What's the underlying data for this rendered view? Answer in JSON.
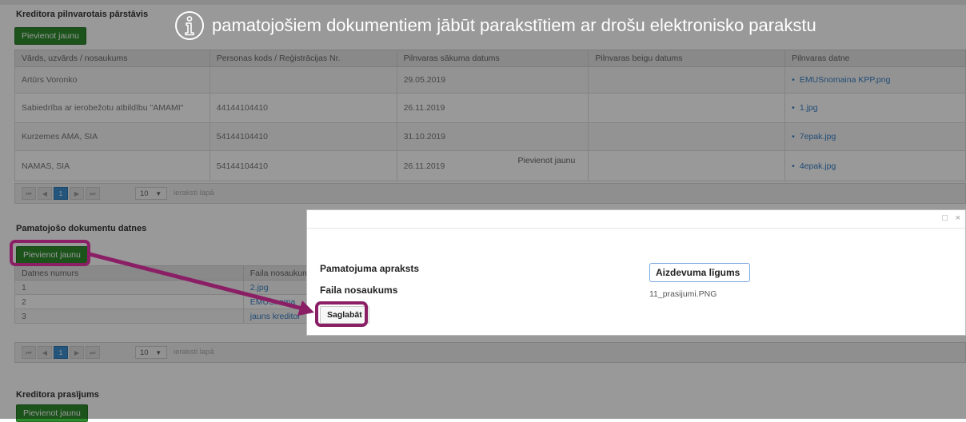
{
  "colors": {
    "primary_green": "#2e8b2e",
    "highlight": "#8b1f66",
    "link": "#3a7fc4",
    "page_active": "#3d8fd0"
  },
  "notice": {
    "icon": "info-circle-icon",
    "text": "pamatojošiem dokumentiem jābūt parakstītiem ar drošu elektronisko parakstu"
  },
  "section1": {
    "title": "Kreditora pilnvarotais pārstāvis",
    "add_label": "Pievienot jaunu",
    "columns": [
      "Vārds, uzvārds / nosaukums",
      "Personas kods / Reģistrācijas Nr.",
      "Pilnvaras sākuma datums",
      "Pilnvaras beigu datums",
      "Pilnvaras datne"
    ],
    "rows": [
      {
        "name": "Artūrs Voronko",
        "code": "",
        "start": "29.05.2019",
        "end": "",
        "file": "EMUSnomaina KPP.png"
      },
      {
        "name": "Sabiedrība ar ierobežotu atbildību \"AMAMI\"",
        "code": "44144104410",
        "start": "26.11.2019",
        "end": "",
        "file": "1.jpg"
      },
      {
        "name": "Kurzemes AMA, SIA",
        "code": "54144104410",
        "start": "31.10.2019",
        "end": "",
        "file": "7epak.jpg"
      },
      {
        "name": "NAMAS, SIA",
        "code": "54144104410",
        "start": "26.11.2019",
        "end": "",
        "file": "4epak.jpg"
      }
    ],
    "row4_inline_action": "Pievienot jaunu",
    "pager": {
      "first": "⏮",
      "prev": "◀",
      "current": "1",
      "next": "▶",
      "last": "⏭",
      "page_size": "10",
      "page_size_caret": "▼",
      "per_page_label": "ieraksti lapā"
    }
  },
  "section2": {
    "title": "Pamatojošo dokumentu datnes",
    "add_label": "Pievienot jaunu",
    "columns": [
      "Datnes numurs",
      "Faila nosaukum"
    ],
    "rows": [
      {
        "num": "1",
        "file": "2.jpg"
      },
      {
        "num": "2",
        "file": "EMUSnoma"
      },
      {
        "num": "3",
        "file": "jauns kreditor"
      }
    ],
    "pager": {
      "first": "⏮",
      "prev": "◀",
      "current": "1",
      "next": "▶",
      "last": "⏭",
      "page_size": "10",
      "page_size_caret": "▼",
      "per_page_label": "ieraksti lapā"
    }
  },
  "section3": {
    "title": "Kreditora prasījums",
    "add_label": "Pievienot jaunu"
  },
  "dialog": {
    "maximize_icon": "□",
    "close_icon": "×",
    "description_label": "Pamatojuma apraksts",
    "description_value": "Aizdevuma līgums",
    "filename_label": "Faila nosaukums",
    "filename_value": "11_prasijumi.PNG",
    "save_label": "Saglabāt"
  }
}
